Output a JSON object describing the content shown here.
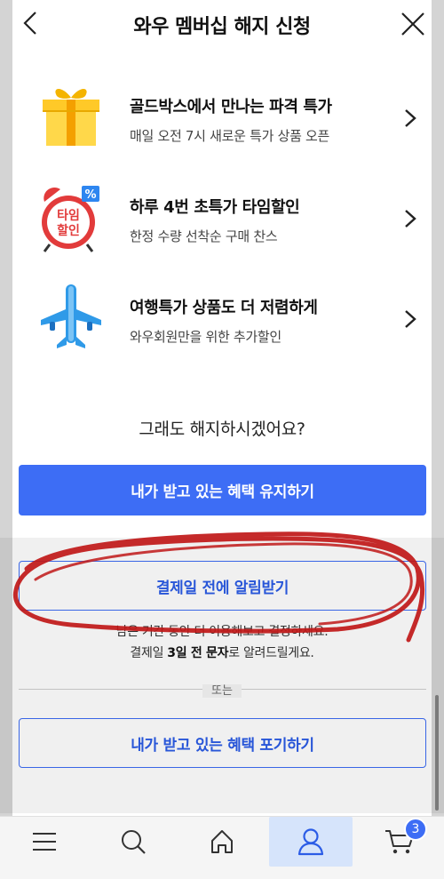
{
  "header": {
    "title": "와우 멤버십 해지 신청"
  },
  "benefits": [
    {
      "title": "골드박스에서 만나는 파격 특가",
      "subtitle": "매일 오전 7시 새로운 특가 상품 오픈",
      "icon": "gift-box-icon"
    },
    {
      "title": "하루 4번 초특가 타임할인",
      "subtitle": "한정 수량 선착순 구매 찬스",
      "icon": "alarm-clock-icon",
      "icon_text": "타임할인",
      "icon_badge": "%"
    },
    {
      "title": "여행특가 상품도 더 저렴하게",
      "subtitle": "와우회원만을 위한 추가할인",
      "icon": "airplane-icon"
    }
  ],
  "question": "그래도 해지하시겠어요?",
  "buttons": {
    "keep": "내가 받고 있는 혜택 유지하기",
    "notify": "결제일 전에 알림받기",
    "give_up": "내가 받고 있는 혜택 포기하기"
  },
  "note": {
    "line1": "남은 기간 동안 더 이용해보고 결정하세요.",
    "line2_prefix": "결제일 ",
    "line2_bold": "3일 전 문자",
    "line2_suffix": "로 알려드릴게요."
  },
  "or_label": "또는",
  "bottom_nav": {
    "cart_badge": "3"
  },
  "colors": {
    "accent": "#3d6df5",
    "annotation": "#c01818"
  }
}
